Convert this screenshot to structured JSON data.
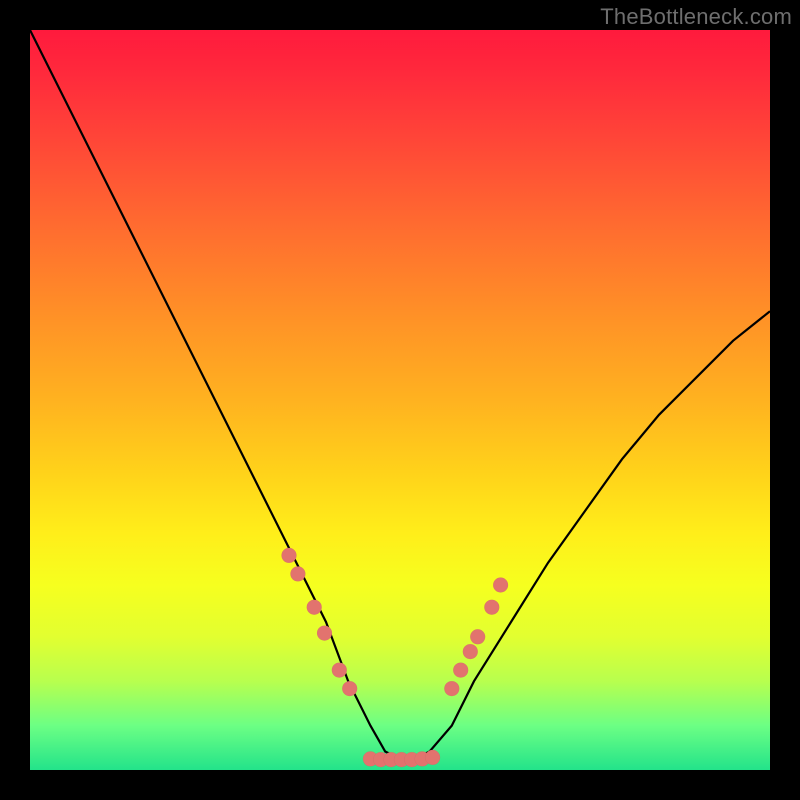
{
  "attribution": "TheBottleneck.com",
  "chart_data": {
    "type": "line",
    "title": "",
    "xlabel": "",
    "ylabel": "",
    "xlim": [
      0,
      100
    ],
    "ylim": [
      0,
      100
    ],
    "grid": false,
    "legend": null,
    "series": [
      {
        "name": "bottleneck-curve",
        "x": [
          0,
          5,
          10,
          15,
          20,
          25,
          30,
          35,
          40,
          43,
          46,
          48,
          50,
          52,
          54,
          57,
          60,
          65,
          70,
          75,
          80,
          85,
          90,
          95,
          100
        ],
        "y": [
          100,
          90,
          80,
          70,
          60,
          50,
          40,
          30,
          20,
          12,
          6,
          2.5,
          1.5,
          1.5,
          2.5,
          6,
          12,
          20,
          28,
          35,
          42,
          48,
          53,
          58,
          62
        ]
      }
    ],
    "markers": [
      {
        "series": "dots-left",
        "x": [
          35.0,
          36.2,
          38.4,
          39.8,
          41.8,
          43.2
        ],
        "y": [
          29,
          26.5,
          22,
          18.5,
          13.5,
          11
        ]
      },
      {
        "series": "dots-right",
        "x": [
          57.0,
          58.2,
          59.5,
          60.5,
          62.4,
          63.6
        ],
        "y": [
          11,
          13.5,
          16,
          18,
          22,
          25
        ]
      },
      {
        "series": "dots-floor",
        "x": [
          46,
          47.4,
          48.8,
          50.2,
          51.6,
          53,
          54.4
        ],
        "y": [
          1.5,
          1.4,
          1.4,
          1.4,
          1.4,
          1.5,
          1.7
        ]
      }
    ],
    "colors": {
      "curve": "#000000",
      "dots": "#e2736e",
      "gradient_top": "#ff1a3d",
      "gradient_bottom": "#23e38a"
    }
  }
}
